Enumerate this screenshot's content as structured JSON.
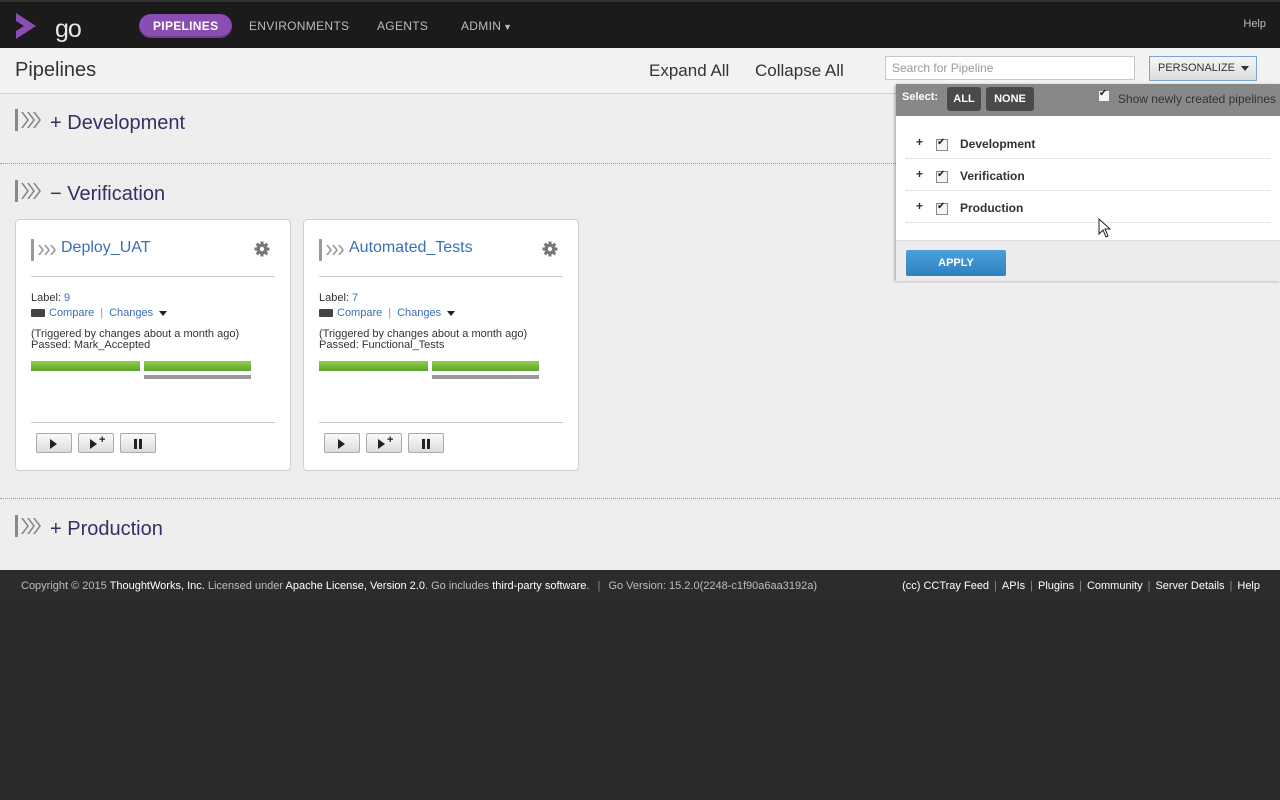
{
  "nav": {
    "logo_text": "go",
    "items": [
      "PIPELINES",
      "ENVIRONMENTS",
      "AGENTS",
      "ADMIN"
    ],
    "help": "Help"
  },
  "header": {
    "title": "Pipelines",
    "expand_all": "Expand All",
    "collapse_all": "Collapse All",
    "search_placeholder": "Search for Pipeline",
    "personalize": "PERSONALIZE"
  },
  "groups": [
    {
      "sign": "+",
      "name": "Development"
    },
    {
      "sign": "−",
      "name": "Verification"
    },
    {
      "sign": "+",
      "name": "Production"
    }
  ],
  "pipelines": [
    {
      "name": "Deploy_UAT",
      "label_prefix": "Label:",
      "label": "9",
      "compare": "Compare",
      "changes": "Changes",
      "triggered": "(Triggered by changes about a month ago)",
      "passed_prefix": "Passed:",
      "passed": "Mark_Accepted"
    },
    {
      "name": "Automated_Tests",
      "label_prefix": "Label:",
      "label": "7",
      "compare": "Compare",
      "changes": "Changes",
      "triggered": "(Triggered by changes about a month ago)",
      "passed_prefix": "Passed:",
      "passed": "Functional_Tests"
    }
  ],
  "personalize_panel": {
    "select_label": "Select:",
    "all": "ALL",
    "none": "NONE",
    "show_new": "Show newly created pipelines",
    "items": [
      {
        "sign": "+",
        "name": "Development",
        "checked": true
      },
      {
        "sign": "+",
        "name": "Verification",
        "checked": true
      },
      {
        "sign": "+",
        "name": "Production",
        "checked": true
      }
    ],
    "apply": "APPLY"
  },
  "footer": {
    "copyright": "Copyright © 2015",
    "company": "ThoughtWorks, Inc.",
    "licensed": "Licensed under",
    "license": "Apache License, Version 2.0",
    "includes": ". Go includes",
    "third_party": "third-party software",
    "version": "Go Version: 15.2.0(2248-c1f90a6aa3192a)",
    "links": [
      "(cc) CCTray Feed",
      "APIs",
      "Plugins",
      "Community",
      "Server Details",
      "Help"
    ]
  },
  "colors": {
    "accent": "#8a4db3",
    "link": "#3b6fb6",
    "group_title": "#3a2c64",
    "passed": "#6ab534"
  }
}
